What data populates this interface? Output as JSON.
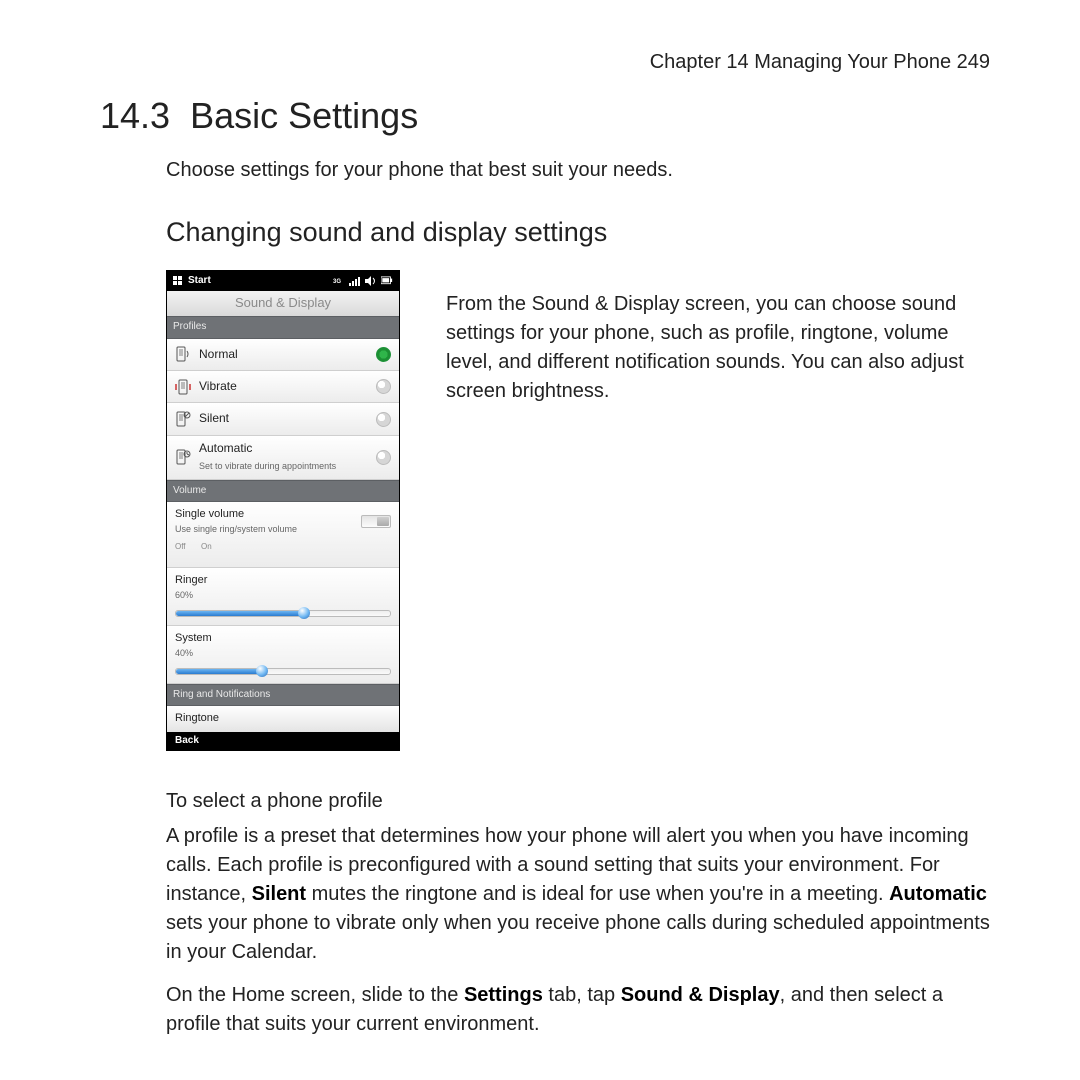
{
  "header": {
    "chapter_line": "Chapter 14  Managing Your Phone  249"
  },
  "section_number": "14.3",
  "section_title": "Basic Settings",
  "intro": "Choose settings for your phone that best suit your needs.",
  "subsection_title": "Changing sound and display settings",
  "screenshot": {
    "start_label": "Start",
    "screen_title": "Sound & Display",
    "section_profiles": "Profiles",
    "profiles": [
      {
        "label": "Normal",
        "sub": "",
        "selected": true
      },
      {
        "label": "Vibrate",
        "sub": "",
        "selected": false
      },
      {
        "label": "Silent",
        "sub": "",
        "selected": false
      },
      {
        "label": "Automatic",
        "sub": "Set to vibrate during appointments",
        "selected": false
      }
    ],
    "section_volume": "Volume",
    "single_volume_label": "Single volume",
    "single_volume_sub": "Use single ring/system volume",
    "toggle_off": "Off",
    "toggle_on": "On",
    "ringer_label": "Ringer",
    "ringer_pct": "60%",
    "ringer_value": 60,
    "system_label": "System",
    "system_pct": "40%",
    "system_value": 40,
    "section_ring": "Ring and Notifications",
    "ringtone_label": "Ringtone",
    "back_label": "Back"
  },
  "description": "From the Sound & Display screen, you can choose sound settings for your phone, such as profile, ringtone, volume level, and different notification sounds. You can also adjust screen brightness.",
  "profile_heading": "To select a phone profile",
  "profile_para_a": "A profile is a preset that determines how your phone will alert you when you have incoming calls. Each profile is preconfigured with a sound setting that suits your environment. For instance, ",
  "profile_silent": "Silent",
  "profile_para_b": " mutes the ringtone and is ideal for use when you're in a meeting. ",
  "profile_auto": "Automatic",
  "profile_para_c": " sets your phone to vibrate only when you receive phone calls during scheduled appointments in your Calendar.",
  "nav_para_a": "On the Home screen, slide to the ",
  "nav_settings": "Settings",
  "nav_para_b": " tab, tap ",
  "nav_sound": "Sound & Display",
  "nav_para_c": ", and then select a profile that suits your current environment."
}
